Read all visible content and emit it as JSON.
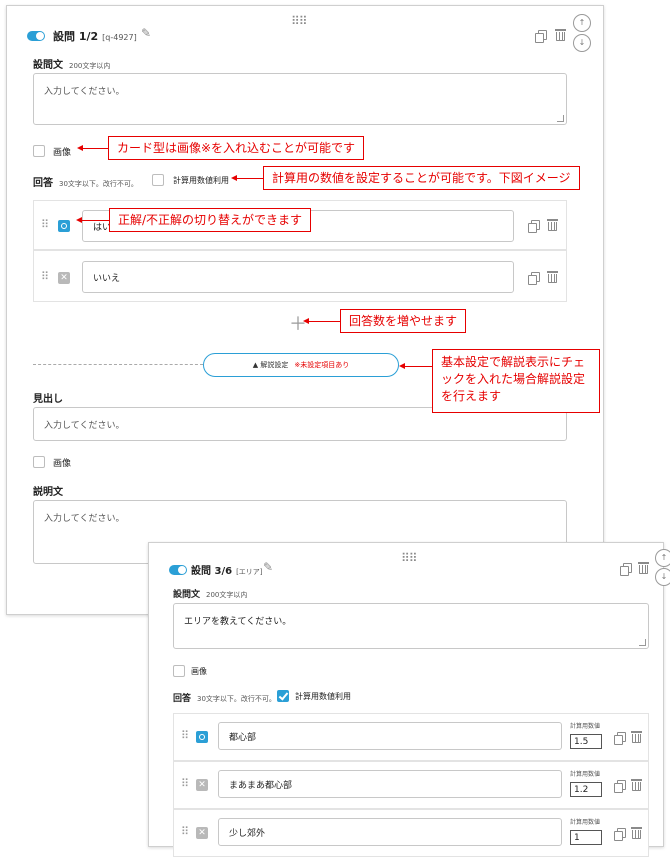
{
  "q1": {
    "title": "設問 1/2",
    "tag": "[q-4927]",
    "question_label": "設問文",
    "question_hint": "200文字以内",
    "question_placeholder": "入力してください。",
    "image_label": "画像",
    "answer_label": "回答",
    "answer_hint": "30文字以下。改行不可。",
    "calc_label": "計算用数値利用",
    "answers": [
      {
        "value": "はい",
        "correct": true
      },
      {
        "value": "いいえ",
        "correct": false
      }
    ],
    "explain_button": "▲ 解説設定",
    "explain_warning": "※未設定項目あり",
    "heading_label": "見出し",
    "heading_placeholder": "入力してください。",
    "image2_label": "画像",
    "desc_label": "説明文",
    "desc_placeholder": "入力してください。"
  },
  "q3": {
    "title": "設問 3/6",
    "tag": "[エリア]",
    "question_label": "設問文",
    "question_hint": "200文字以内",
    "question_value": "エリアを教えてください。",
    "image_label": "画像",
    "answer_label": "回答",
    "answer_hint": "30文字以下。改行不可。",
    "calc_label": "計算用数値利用",
    "calc_checked": true,
    "num_label": "計算用数値",
    "answers": [
      {
        "value": "都心部",
        "num": "1.5",
        "correct": true
      },
      {
        "value": "まあまあ都心部",
        "num": "1.2",
        "correct": false
      },
      {
        "value": "少し郊外",
        "num": "1",
        "correct": false
      }
    ]
  },
  "callouts": {
    "card": "カード型は画像※を入れ込むことが可能です",
    "calc": "計算用の数値を設定することが可能です。下図イメージ",
    "correct": "正解/不正解の切り替えができます",
    "add": "回答数を増やせます",
    "explain": "基本設定で解説表示にチェックを入れた場合解説設定を行えます"
  },
  "colors": {
    "accent": "#2b9fd6",
    "callout": "#e60000"
  },
  "icons": [
    "toggle-icon",
    "pencil-icon",
    "copy-icon",
    "trash-icon",
    "drag-handle-icon",
    "arrow-up-icon",
    "arrow-down-icon",
    "plus-icon",
    "correct-icon",
    "incorrect-icon"
  ]
}
